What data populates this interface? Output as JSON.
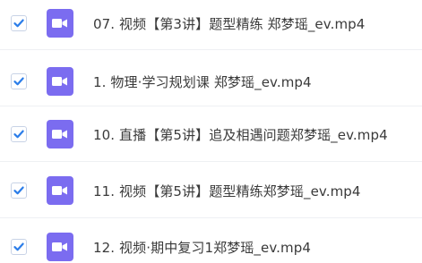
{
  "file_list": {
    "items": [
      {
        "name": "07. 视频【第3讲】题型精练 郑梦瑶_ev.mp4",
        "checked": true,
        "icon": "video-file-icon"
      },
      {
        "name": "1. 物理·学习规划课 郑梦瑶_ev.mp4",
        "checked": true,
        "icon": "video-file-icon"
      },
      {
        "name": "10. 直播【第5讲】追及相遇问题郑梦瑶_ev.mp4",
        "checked": true,
        "icon": "video-file-icon"
      },
      {
        "name": "11. 视频【第5讲】题型精练郑梦瑶_ev.mp4",
        "checked": true,
        "icon": "video-file-icon"
      },
      {
        "name": "12. 视频·期中复习1郑梦瑶_ev.mp4",
        "checked": true,
        "icon": "video-file-icon"
      }
    ]
  },
  "colors": {
    "checkbox_check": "#2b7de9",
    "video_icon_bg": "#7b6cf0",
    "text": "#3a3a3a"
  }
}
